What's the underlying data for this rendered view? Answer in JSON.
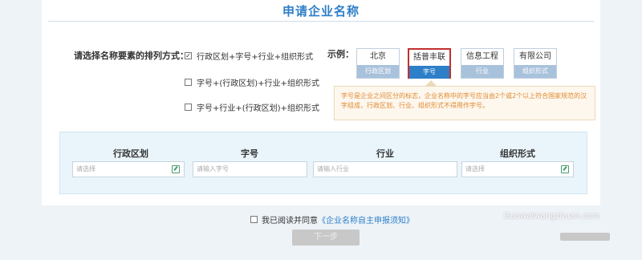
{
  "page": {
    "title": "申请企业名称"
  },
  "order": {
    "label": "请选择名称要素的排列方式：",
    "options": [
      {
        "label": "行政区划+字号+行业+组织形式",
        "checked": true,
        "check_mark": "✓"
      },
      {
        "label": "字号+(行政区划)+行业+组织形式",
        "checked": false
      },
      {
        "label": "字号+行业+(行政区划)+组织形式",
        "checked": false
      }
    ]
  },
  "example": {
    "label": "示例：",
    "cards": [
      {
        "value": "北京",
        "type": "行政区划"
      },
      {
        "value": "括普丰联",
        "type": "字号",
        "active": true
      },
      {
        "value": "信息工程",
        "type": "行业"
      },
      {
        "value": "有限公司",
        "type": "组织形式"
      }
    ],
    "tip": "字号是企业之间区分的标志，企业名称中的字号应当由2个或2个以上符合国家规范的汉字组成，行政区划、行业、组织形式不得用作字号。"
  },
  "fields": [
    {
      "label": "行政区划",
      "placeholder": "请选择",
      "icon": "edit-icon"
    },
    {
      "label": "字号",
      "placeholder": "请输入字号"
    },
    {
      "label": "行业",
      "placeholder": "请输入行业"
    },
    {
      "label": "组织形式",
      "placeholder": "请选择",
      "icon": "edit-icon"
    }
  ],
  "agree": {
    "text": "我已阅读并同意",
    "link": "《企业名称自主申报须知》"
  },
  "next_button": "下一步",
  "watermark": "Guowaiwangzhuan.com"
}
